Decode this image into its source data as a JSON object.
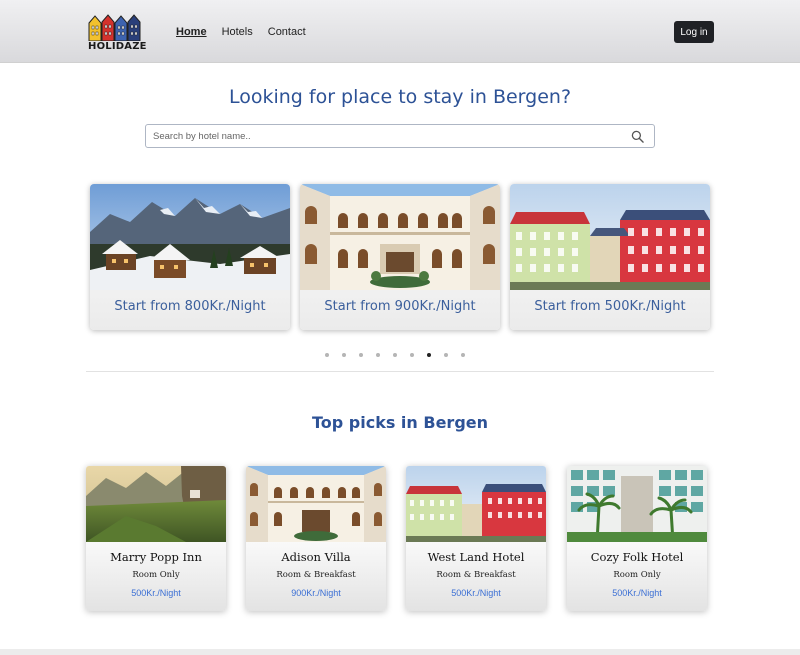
{
  "brand": {
    "name": "HOLIDAZE",
    "colors": [
      "#f2c12e",
      "#d4322c",
      "#3d63b0",
      "#2a3f7a"
    ]
  },
  "nav": {
    "links": [
      {
        "label": "Home",
        "active": true
      },
      {
        "label": "Hotels",
        "active": false
      },
      {
        "label": "Contact",
        "active": false
      }
    ],
    "login_label": "Log in"
  },
  "hero": {
    "title": "Looking for place to stay in Bergen?",
    "search_placeholder": "Search by hotel name..",
    "search_value": ""
  },
  "carousel": {
    "slides": [
      {
        "caption": "Start from 800Kr./Night",
        "image": "snowy-mountain-village"
      },
      {
        "caption": "Start from 900Kr./Night",
        "image": "hotel-courtyard-arches"
      },
      {
        "caption": "Start from 500Kr./Night",
        "image": "colorful-city-buildings"
      }
    ],
    "dot_count": 9,
    "active_dot": 6
  },
  "top_picks": {
    "title": "Top picks in Bergen",
    "hotels": [
      {
        "name": "Marry Popp Inn",
        "board": "Room Only",
        "price": "500Kr./Night",
        "image": "mountain-cliff-valley"
      },
      {
        "name": "Adison Villa",
        "board": "Room & Breakfast",
        "price": "900Kr./Night",
        "image": "hotel-courtyard-arches"
      },
      {
        "name": "West Land Hotel",
        "board": "Room & Breakfast",
        "price": "500Kr./Night",
        "image": "colorful-city-buildings"
      },
      {
        "name": "Cozy Folk Hotel",
        "board": "Room Only",
        "price": "500Kr./Night",
        "image": "palm-tree-hotel"
      }
    ]
  },
  "accent_color": "#2d5296",
  "price_color": "#3b6fd4"
}
